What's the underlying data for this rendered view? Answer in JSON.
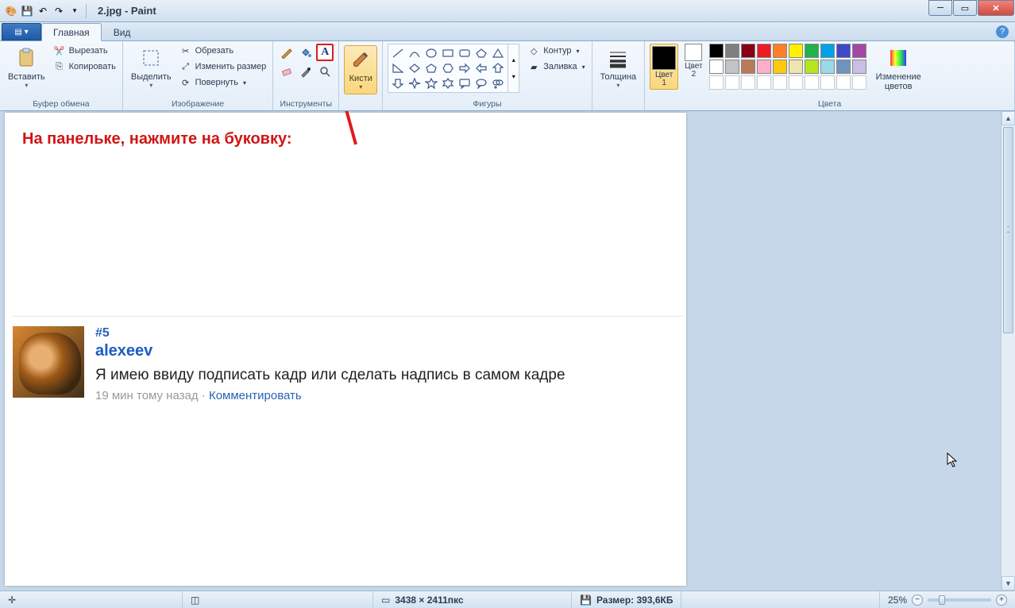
{
  "title": "2.jpg - Paint",
  "tabs": {
    "home": "Главная",
    "view": "Вид"
  },
  "clipboard": {
    "paste": "Вставить",
    "cut": "Вырезать",
    "copy": "Копировать",
    "group": "Буфер обмена"
  },
  "image": {
    "select": "Выделить",
    "crop": "Обрезать",
    "resize": "Изменить размер",
    "rotate": "Повернуть",
    "group": "Изображение"
  },
  "tools": {
    "group": "Инструменты"
  },
  "brush": {
    "label": "Кисти"
  },
  "shapes": {
    "outline": "Контур",
    "fill": "Заливка",
    "group": "Фигуры"
  },
  "size": {
    "label": "Толщина"
  },
  "colors": {
    "c1": "Цвет\n1",
    "c2": "Цвет\n2",
    "edit": "Изменение\nцветов",
    "group": "Цвета",
    "c1hex": "#000000",
    "c2hex": "#ffffff",
    "row1": [
      "#000000",
      "#7f7f7f",
      "#880015",
      "#ed1c24",
      "#ff7f27",
      "#fff200",
      "#22b14c",
      "#00a2e8",
      "#3f48cc",
      "#a349a4"
    ],
    "row2": [
      "#ffffff",
      "#c3c3c3",
      "#b97a57",
      "#ffaec9",
      "#ffc90e",
      "#efe4b0",
      "#b5e61d",
      "#99d9ea",
      "#7092be",
      "#c8bfe7"
    ]
  },
  "canvas_annotation": "На панельке, нажмите на буковку:",
  "comment": {
    "num": "#5",
    "user": "alexeev",
    "text": "Я имею ввиду подписать кадр или сделать надпись в самом кадре",
    "time": "19 мин тому назад",
    "sep": " · ",
    "action": "Комментировать"
  },
  "status": {
    "dims": "3438 × 2411пкс",
    "size_label": "Размер: ",
    "size_val": "393,6КБ",
    "zoom": "25%"
  }
}
